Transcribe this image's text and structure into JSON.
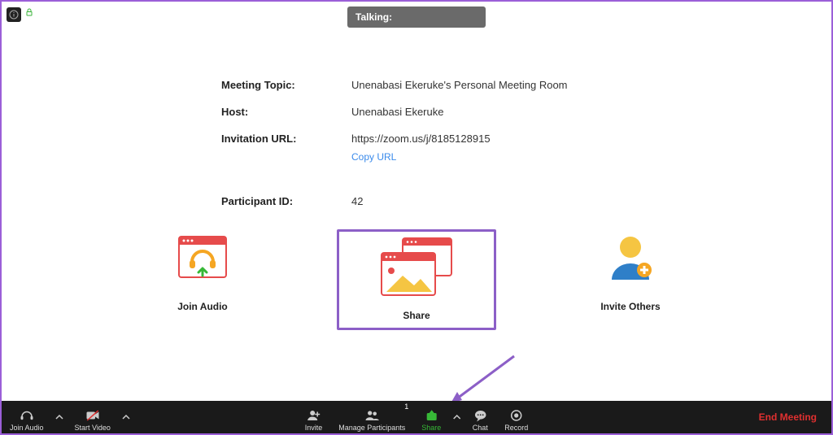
{
  "header": {
    "talking_label": "Talking:"
  },
  "meeting": {
    "topic_label": "Meeting Topic:",
    "topic_value": "Unenabasi Ekeruke's Personal Meeting Room",
    "host_label": "Host:",
    "host_value": "Unenabasi Ekeruke",
    "url_label": "Invitation URL:",
    "url_value": "https://zoom.us/j/8185128915",
    "copy_url": "Copy URL",
    "participant_id_label": "Participant ID:",
    "participant_id_value": "42"
  },
  "actions": {
    "join_audio": "Join Audio",
    "share": "Share",
    "invite_others": "Invite Others"
  },
  "toolbar": {
    "join_audio": "Join Audio",
    "start_video": "Start Video",
    "invite": "Invite",
    "manage_participants": "Manage Participants",
    "participants_count": "1",
    "share": "Share",
    "chat": "Chat",
    "record": "Record",
    "end_meeting": "End Meeting"
  },
  "colors": {
    "accent_green": "#37b837",
    "accent_red": "#e64b4b",
    "accent_orange": "#f5a623",
    "accent_blue": "#2f7fc8",
    "highlight_purple": "#8c5fc7",
    "link_blue": "#3b8beb",
    "danger_red": "#e03030"
  }
}
